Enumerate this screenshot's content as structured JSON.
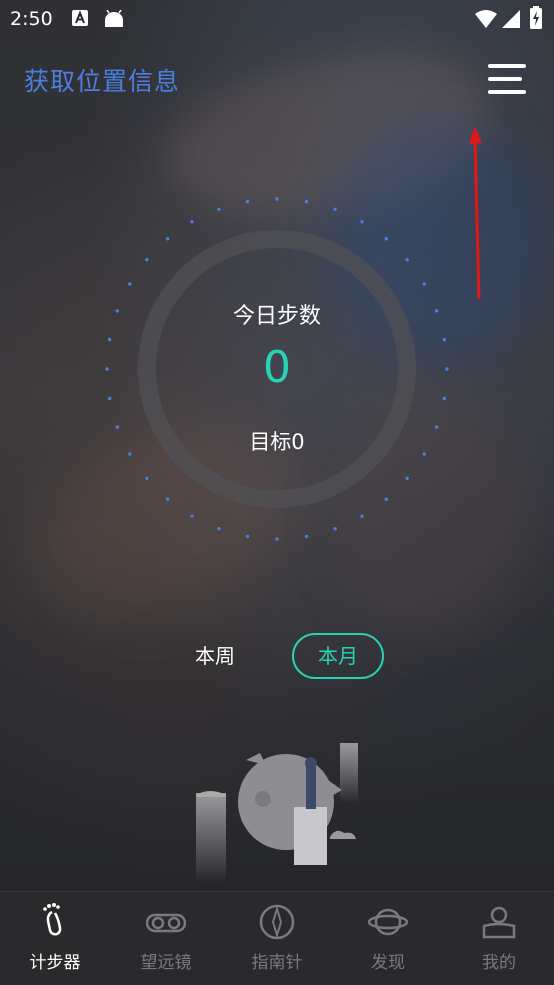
{
  "status_bar": {
    "time": "2:50"
  },
  "header": {
    "title": "获取位置信息"
  },
  "dial": {
    "label": "今日步数",
    "steps": "0",
    "target": "目标0"
  },
  "period_tabs": [
    {
      "label": "本周",
      "selected": false
    },
    {
      "label": "本月",
      "selected": true
    }
  ],
  "tab_bar": [
    {
      "label": "计步器",
      "icon": "footprint-icon",
      "active": true
    },
    {
      "label": "望远镜",
      "icon": "binoculars-icon",
      "active": false
    },
    {
      "label": "指南针",
      "icon": "compass-icon",
      "active": false
    },
    {
      "label": "发现",
      "icon": "planet-icon",
      "active": false
    },
    {
      "label": "我的",
      "icon": "profile-icon",
      "active": false
    }
  ],
  "colors": {
    "accent": "#27d3b5",
    "title_blue": "#4a7fe0",
    "dots": "#4a7fe0",
    "arrow": "#e01818"
  }
}
